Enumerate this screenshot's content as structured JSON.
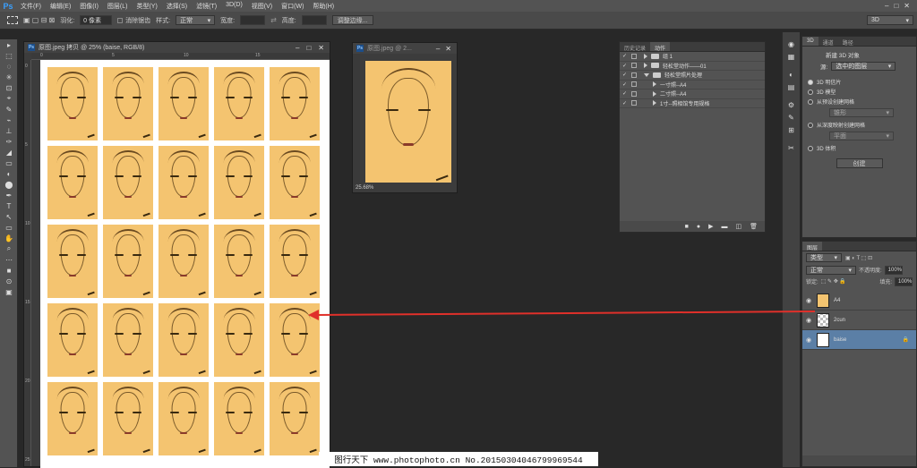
{
  "menubar": {
    "logo": "Ps",
    "items": [
      "文件(F)",
      "编辑(E)",
      "图像(I)",
      "图层(L)",
      "类型(Y)",
      "选择(S)",
      "滤镜(T)",
      "3D(D)",
      "视图(V)",
      "窗口(W)",
      "帮助(H)"
    ]
  },
  "options": {
    "feather_label": "羽化:",
    "feather_value": "0 像素",
    "antialias_label": "消除锯齿",
    "style_label": "样式:",
    "style_value": "正常",
    "width_label": "宽度:",
    "height_label": "高度:",
    "refine_button": "调整边缘...",
    "workspace_value": "3D"
  },
  "tools": [
    "▸",
    "⬚",
    "◌",
    "✳",
    "⊡",
    "⌖",
    "✎",
    "⌁",
    "⊥",
    "✑",
    "◢",
    "▭",
    "◐",
    "⬤",
    "✒",
    "T",
    "↖",
    "▭",
    "✋",
    "⌕",
    "⋯",
    "■",
    "⊙",
    "▣"
  ],
  "doc_main": {
    "title": "原图.jpeg 拷贝 @ 25% (baise, RGB/8)",
    "ruler_top": [
      "0",
      "5",
      "10",
      "15"
    ],
    "ruler_left": [
      "0",
      "5",
      "10",
      "15",
      "20",
      "25"
    ]
  },
  "doc_small": {
    "title": "原图.jpeg @ 2...",
    "zoom": "25.68%"
  },
  "history_panel": {
    "tab_history": "历史记录",
    "tab_actions": "动作",
    "rows": [
      {
        "label": "组 1",
        "indent": 0,
        "kind": "folder"
      },
      {
        "label": "轻松堂动作——01",
        "indent": 0,
        "kind": "folder"
      },
      {
        "label": "轻松堂照片处理",
        "indent": 0,
        "kind": "folder-open"
      },
      {
        "label": "一寸照--A4",
        "indent": 1,
        "kind": "action"
      },
      {
        "label": "二寸照--A4",
        "indent": 1,
        "kind": "action"
      },
      {
        "label": "1寸--照相馆专用规格",
        "indent": 1,
        "kind": "action"
      }
    ]
  },
  "panel_3d": {
    "tabs": [
      "3D",
      "通道",
      "路径"
    ],
    "header": "新建 3D 对象",
    "source_label": "源:",
    "source_value": "选中的图层",
    "options": [
      "3D 明信片",
      "3D 模型",
      "从预设创建网格",
      "从深度映射创建网格",
      "3D 体积"
    ],
    "preset_value": "锥形",
    "depth_value": "平面",
    "create_button": "创建"
  },
  "layers_panel": {
    "tab": "图层",
    "kind_label": "类型",
    "mode_value": "正常",
    "opacity_label": "不透明度:",
    "opacity_value": "100%",
    "lock_label": "锁定:",
    "fill_label": "填充:",
    "fill_value": "100%",
    "layers": [
      {
        "name": "A4",
        "selected": false
      },
      {
        "name": "2cun",
        "selected": false
      },
      {
        "name": "baise",
        "selected": true
      }
    ]
  },
  "watermark": {
    "text": "图行天下 www.photophoto.cn  No.20150304046799969544"
  },
  "colors": {
    "photo_bg": "#f4c470",
    "arrow": "#e0302a",
    "layer_selected": "#5b7fa6"
  }
}
